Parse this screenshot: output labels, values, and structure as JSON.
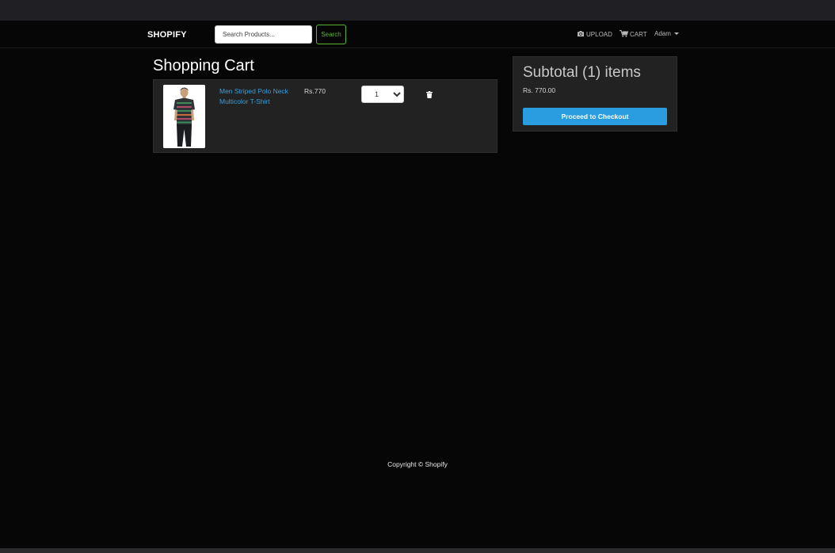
{
  "navbar": {
    "brand": "SHOPIFY",
    "search_placeholder": "Search Products...",
    "search_button": "Search",
    "upload_label": "UPLOAD",
    "cart_label": "CART",
    "user_name": "Adam"
  },
  "cart": {
    "title": "Shopping Cart",
    "items": [
      {
        "name": "Men Striped Polo Neck Multicolor T-Shirt",
        "price": "Rs.770",
        "quantity": "1"
      }
    ]
  },
  "summary": {
    "title": "Subtotal (1) items",
    "amount": "Rs. 770.00",
    "checkout_label": "Proceed to Checkout"
  },
  "footer": {
    "copyright": "Copyright © Shopify"
  },
  "colors": {
    "link": "#3a9fd8",
    "search_button": "#59b530",
    "checkout_button": "#2a9de0",
    "card_background": "#222222"
  },
  "icons": {
    "upload": "camera-icon",
    "cart": "shopping-cart-icon",
    "delete": "trash-icon"
  }
}
